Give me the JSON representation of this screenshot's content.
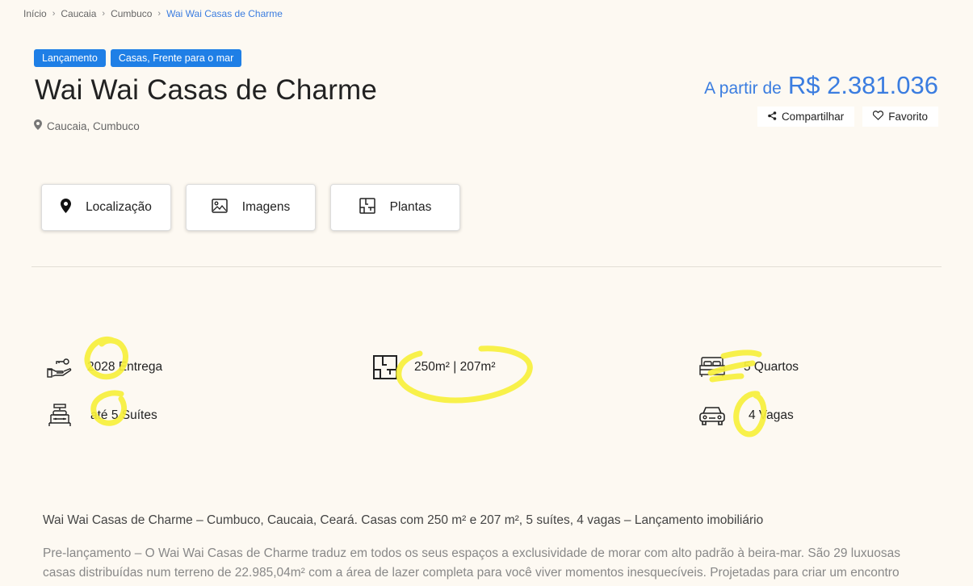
{
  "breadcrumb": [
    "Início",
    "Caucaia",
    "Cumbuco",
    "Wai Wai Casas de Charme"
  ],
  "badges": [
    "Lançamento",
    "Casas, Frente para o mar"
  ],
  "title": "Wai Wai Casas de Charme",
  "location": "Caucaia, Cumbuco",
  "price": {
    "prefix": "A partir de",
    "amount": "R$ 2.381.036"
  },
  "actions": {
    "share": "Compartilhar",
    "favorite": "Favorito"
  },
  "tabs": [
    "Localização",
    "Imagens",
    "Plantas"
  ],
  "features": {
    "delivery": "2028 Entrega",
    "suites": "até 5 Suítes",
    "area": "250m² | 207m²",
    "rooms": "5 Quartos",
    "parking": "4 Vagas"
  },
  "description": {
    "title": "Wai Wai Casas de Charme – Cumbuco, Caucaia, Ceará. Casas com 250 m² e 207 m², 5 suítes, 4 vagas – Lançamento imobiliário",
    "body": "Pre-lançamento – O Wai Wai Casas de Charme traduz em todos os seus espaços a exclusividade de morar com alto padrão à beira-mar. São 29 luxuosas casas distribuídas num terreno de 22.985,04m² com a área de lazer completa para você viver momentos inesquecíveis. Projetadas para criar um encontro"
  },
  "colors": {
    "accent": "#3b7de0",
    "badge": "#1f7fe6",
    "background": "#fdf9f2",
    "highlight": "#f7f03c"
  }
}
